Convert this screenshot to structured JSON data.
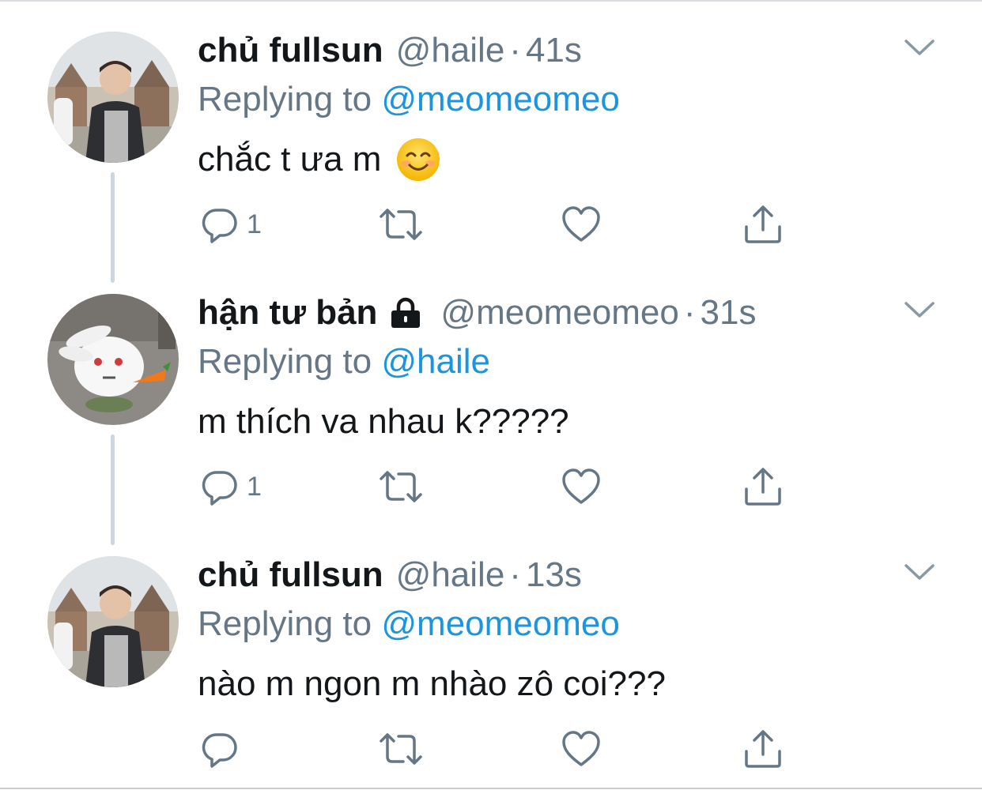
{
  "tweets": [
    {
      "name": "chủ fullsun",
      "handle": "@haile",
      "time": "41s",
      "reply_prefix": "Replying to",
      "reply_to": "@meomeomeo",
      "text": "chắc t ưa m",
      "emoji": "smiling-face-emoji",
      "reply_count": "1",
      "locked": false
    },
    {
      "name": "hận tư bản",
      "handle": "@meomeomeo",
      "time": "31s",
      "reply_prefix": "Replying to",
      "reply_to": "@haile",
      "text": "m thích va nhau k?????",
      "reply_count": "1",
      "locked": true
    },
    {
      "name": "chủ fullsun",
      "handle": "@haile",
      "time": "13s",
      "reply_prefix": "Replying to",
      "reply_to": "@meomeomeo",
      "text": "nào m ngon m nhào zô coi???",
      "reply_count": "",
      "locked": false
    }
  ],
  "separator": "·",
  "icons": [
    "reply-icon",
    "retweet-icon",
    "like-icon",
    "share-icon",
    "chevron-down-icon",
    "lock-icon"
  ],
  "colors": {
    "text": "#14171a",
    "secondary": "#657786",
    "link": "#1b95e0",
    "thread_line": "#cdd5dd"
  }
}
